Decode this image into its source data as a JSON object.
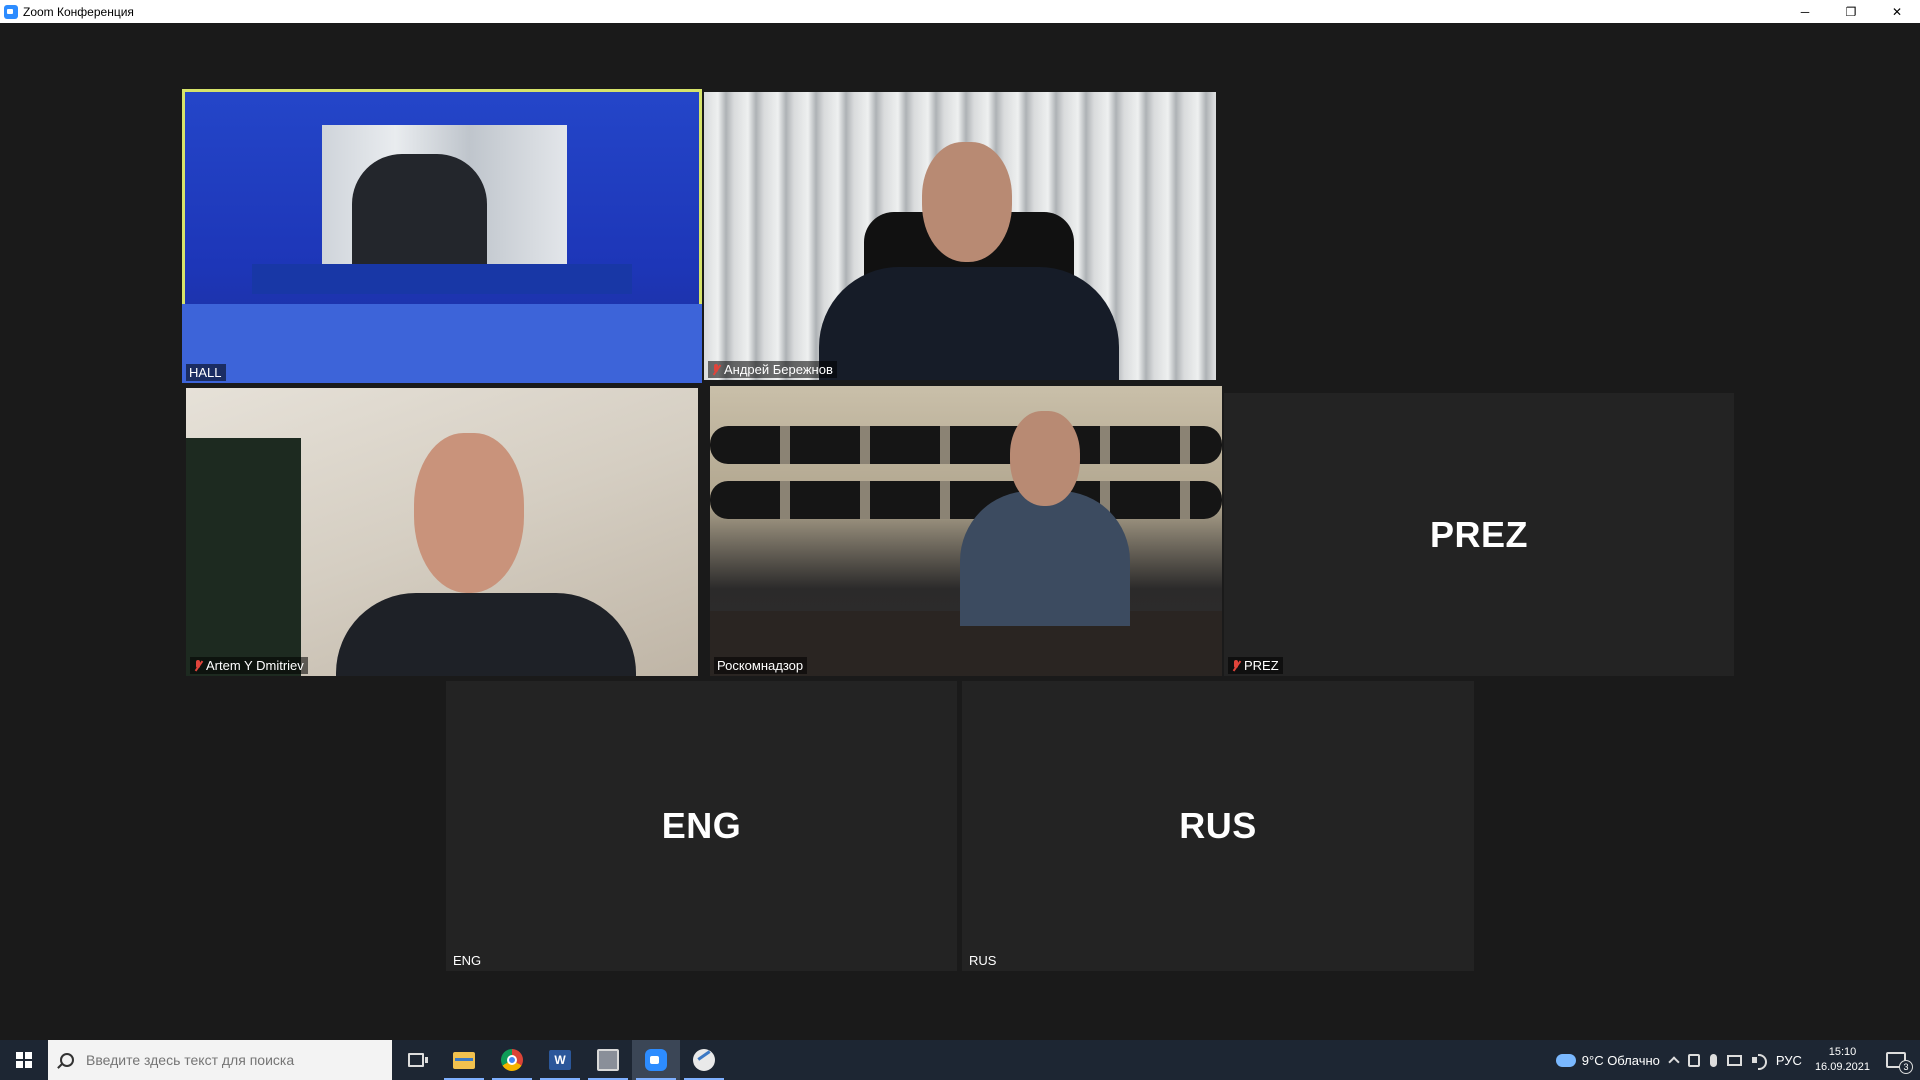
{
  "window": {
    "title": "Zoom Конференция",
    "minimize": "─",
    "restore": "❐",
    "close": "✕"
  },
  "tiles": {
    "hall": {
      "label": "HALL"
    },
    "andrey": {
      "label": "Андрей Бережнов",
      "muted": true
    },
    "artem": {
      "label": "Artem Y Dmitriev",
      "muted": true
    },
    "rkn": {
      "label": "Роскомнадзор"
    },
    "prez": {
      "label": "PREZ",
      "display_name": "PREZ",
      "muted": true
    },
    "eng": {
      "label": "ENG",
      "display_name": "ENG"
    },
    "rus": {
      "label": "RUS",
      "display_name": "RUS"
    }
  },
  "colors": {
    "active_speaker_border": "#d6e36a",
    "muted_icon": "#e0443b",
    "taskbar": "#1d2633"
  },
  "taskbar": {
    "search_placeholder": "Введите здесь текст для поиска",
    "word_letter": "W",
    "weather": "9°C  Облачно",
    "language": "РУС",
    "time": "15:10",
    "date": "16.09.2021",
    "notifications": "3"
  }
}
